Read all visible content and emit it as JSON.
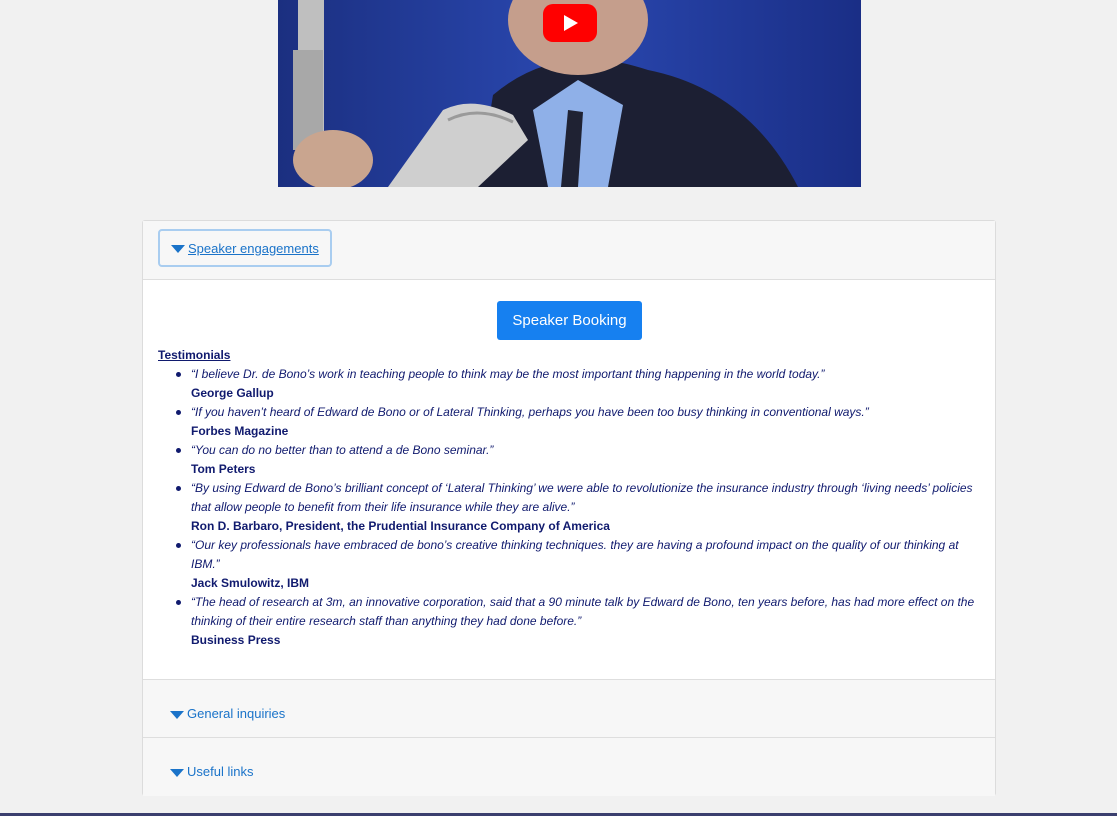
{
  "video": {
    "play_icon": "youtube-play-icon"
  },
  "accordion": {
    "speaker_engagements": "Speaker engagements",
    "general_inquiries": "General inquiries",
    "useful_links": "Useful links"
  },
  "speaker_section": {
    "booking_button": "Speaker Booking",
    "testimonials_title": "Testimonials",
    "testimonials": [
      {
        "quote": "“I believe Dr. de Bono’s work in teaching people to think may be the most important thing happening in the world today.”",
        "author": "George Gallup"
      },
      {
        "quote": "“If you haven’t heard of Edward de Bono or of Lateral Thinking, perhaps you have been too busy thinking in conventional ways.”",
        "author": "Forbes Magazine"
      },
      {
        "quote": "“You can do no better than to attend a de Bono seminar.”",
        "author": "Tom Peters"
      },
      {
        "quote": "“By using Edward de Bono’s brilliant concept of ‘Lateral Thinking’ we were able to revolutionize the insurance industry through ‘living needs’ policies that allow people to benefit from their life insurance while they are alive.”",
        "author": "Ron D. Barbaro, President, the Prudential Insurance Company of America"
      },
      {
        "quote": "“Our key professionals have embraced de bono’s creative thinking techniques. they are having a profound impact on the quality of our thinking at IBM.”",
        "author": "Jack Smulowitz, IBM"
      },
      {
        "quote": "“The head of research at 3m, an innovative corporation, said that a 90 minute talk by Edward de Bono, ten years before, has had more effect on the thinking of their entire research staff than anything they had done before.”",
        "author": "Business Press"
      }
    ]
  },
  "colors": {
    "accent": "#1a73c9",
    "button": "#1680f0",
    "text": "#101a6e",
    "youtube_red": "#ff0000"
  }
}
